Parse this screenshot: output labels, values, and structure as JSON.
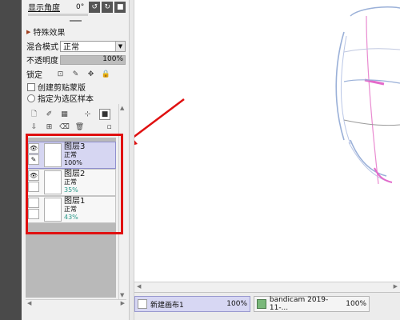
{
  "panel": {
    "display_angle_label": "显示角度",
    "display_angle_value": "0°",
    "special_effects_label": "特殊效果",
    "blend_mode_label": "混合模式",
    "blend_mode_value": "正常",
    "opacity_label": "不透明度",
    "opacity_value": "100%",
    "lock_label": "锁定",
    "create_clipping_label": "创建剪贴蒙版",
    "specify_selection_sample_label": "指定为选区样本"
  },
  "layers": [
    {
      "name": "图层3",
      "mode": "正常",
      "opacity": "100%",
      "visible": true,
      "selected": true,
      "opacity_fraction": 1.0
    },
    {
      "name": "图层2",
      "mode": "正常",
      "opacity": "35%",
      "visible": true,
      "selected": false,
      "opacity_fraction": 0.35
    },
    {
      "name": "图层1",
      "mode": "正常",
      "opacity": "43%",
      "visible": false,
      "selected": false,
      "opacity_fraction": 0.43
    }
  ],
  "taskbar": {
    "tabs": [
      {
        "label": "新建画布1",
        "zoom": "100%",
        "active": true
      },
      {
        "label": "bandicam 2019-11-...",
        "zoom": "100%",
        "active": false
      }
    ]
  },
  "colors": {
    "annotation": "#e01010",
    "selected_layer": "#d6d6f2",
    "teal_text": "#2a9a8a"
  }
}
